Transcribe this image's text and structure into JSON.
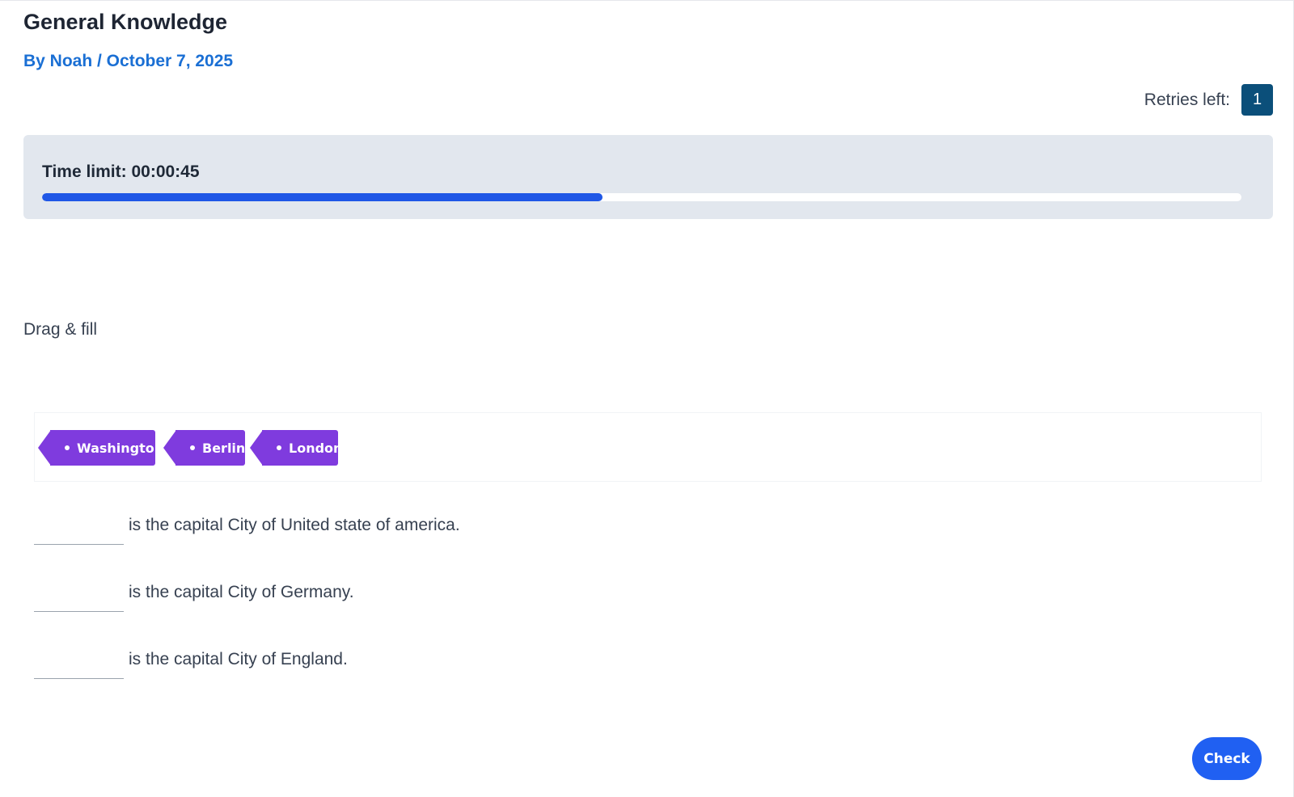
{
  "quiz": {
    "title": "General Knowledge",
    "byline": "By Noah / October 7, 2025"
  },
  "retries": {
    "label": "Retries left:",
    "count": "1"
  },
  "timer": {
    "label": "Time limit: 00:00:45",
    "progress_percent": 46.7
  },
  "task": {
    "instructions": "Drag & fill"
  },
  "word_bank": {
    "tags": [
      {
        "label": "Washington"
      },
      {
        "label": "Berlin"
      },
      {
        "label": "London"
      }
    ]
  },
  "sentences": [
    {
      "text": "is the capital City of United state of america."
    },
    {
      "text": "is the capital City of Germany."
    },
    {
      "text": "is the capital City of England."
    }
  ],
  "actions": {
    "check_label": "Check"
  },
  "colors": {
    "tag": "#7f3bde",
    "progress": "#1f57e6",
    "byline": "#1a6fd4",
    "retries_badge": "#0b4f7a",
    "check_button": "#2060f2"
  }
}
